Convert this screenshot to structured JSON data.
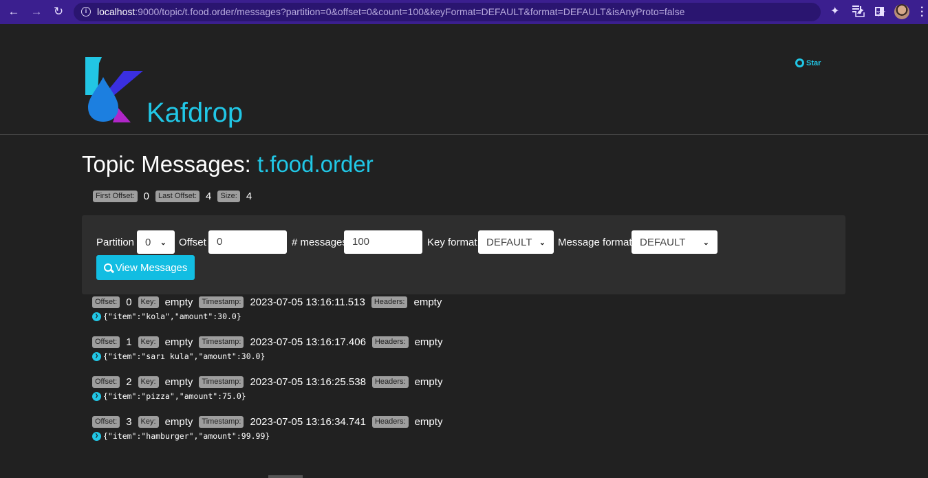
{
  "browser": {
    "url_host": "localhost",
    "url_rest": ":9000/topic/t.food.order/messages?partition=0&offset=0&count=100&keyFormat=DEFAULT&format=DEFAULT&isAnyProto=false"
  },
  "header": {
    "brand": "Kafdrop",
    "star_label": "Star"
  },
  "page": {
    "title_prefix": "Topic Messages:",
    "topic_name": "t.food.order"
  },
  "stats": {
    "first_offset_label": "First Offset:",
    "first_offset": "0",
    "last_offset_label": "Last Offset:",
    "last_offset": "4",
    "size_label": "Size:",
    "size": "4"
  },
  "form": {
    "partition_label": "Partition",
    "partition_value": "0",
    "offset_label": "Offset",
    "offset_value": "0",
    "messages_label": "# messages",
    "messages_value": "100",
    "key_format_label": "Key format",
    "key_format_value": "DEFAULT",
    "message_format_label": "Message format",
    "message_format_value": "DEFAULT",
    "view_button": "View Messages"
  },
  "labels": {
    "offset": "Offset:",
    "key": "Key:",
    "timestamp": "Timestamp:",
    "headers": "Headers:"
  },
  "messages": [
    {
      "offset": "0",
      "key": "empty",
      "timestamp": "2023-07-05 13:16:11.513",
      "headers": "empty",
      "body": "{\"item\":\"kola\",\"amount\":30.0}"
    },
    {
      "offset": "1",
      "key": "empty",
      "timestamp": "2023-07-05 13:16:17.406",
      "headers": "empty",
      "body": "{\"item\":\"sarı kula\",\"amount\":30.0}"
    },
    {
      "offset": "2",
      "key": "empty",
      "timestamp": "2023-07-05 13:16:25.538",
      "headers": "empty",
      "body": "{\"item\":\"pizza\",\"amount\":75.0}"
    },
    {
      "offset": "3",
      "key": "empty",
      "timestamp": "2023-07-05 13:16:34.741",
      "headers": "empty",
      "body": "{\"item\":\"hamburger\",\"amount\":99.99}"
    }
  ]
}
